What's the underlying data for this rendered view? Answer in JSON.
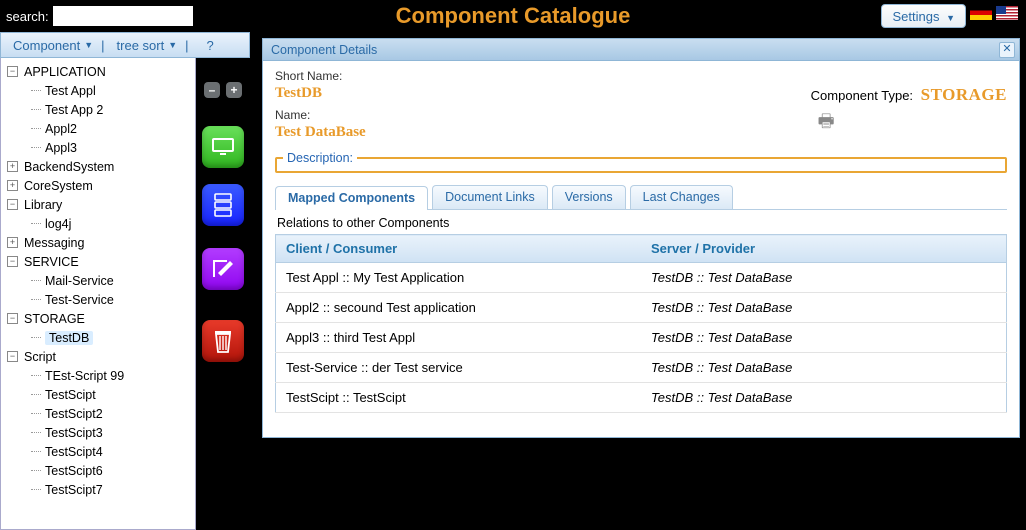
{
  "header": {
    "search_label": "search:",
    "search_value": "",
    "title": "Component Catalogue",
    "settings_label": "Settings"
  },
  "toolbar": {
    "component_label": "Component",
    "sort_label": "tree sort",
    "help_label": "?"
  },
  "tree": [
    {
      "label": "APPLICATION",
      "depth": 0,
      "exp": "-"
    },
    {
      "label": "Test Appl",
      "depth": 1
    },
    {
      "label": "Test App 2",
      "depth": 1
    },
    {
      "label": "Appl2",
      "depth": 1
    },
    {
      "label": "Appl3",
      "depth": 1
    },
    {
      "label": "BackendSystem",
      "depth": 0,
      "exp": "+"
    },
    {
      "label": "CoreSystem",
      "depth": 0,
      "exp": "+"
    },
    {
      "label": "Library",
      "depth": 0,
      "exp": "-"
    },
    {
      "label": "log4j",
      "depth": 1
    },
    {
      "label": "Messaging",
      "depth": 0,
      "exp": "+"
    },
    {
      "label": "SERVICE",
      "depth": 0,
      "exp": "-"
    },
    {
      "label": "Mail-Service",
      "depth": 1
    },
    {
      "label": "Test-Service",
      "depth": 1
    },
    {
      "label": "STORAGE",
      "depth": 0,
      "exp": "-"
    },
    {
      "label": "TestDB",
      "depth": 1,
      "selected": true
    },
    {
      "label": "Script",
      "depth": 0,
      "exp": "-"
    },
    {
      "label": "TEst-Script 99",
      "depth": 1
    },
    {
      "label": "TestScipt",
      "depth": 1
    },
    {
      "label": "TestScipt2",
      "depth": 1
    },
    {
      "label": "TestScipt3",
      "depth": 1
    },
    {
      "label": "TestScipt4",
      "depth": 1
    },
    {
      "label": "TestScipt6",
      "depth": 1
    },
    {
      "label": "TestScipt7",
      "depth": 1
    }
  ],
  "side_icons": {
    "collapse": "–",
    "expand": "+"
  },
  "panel": {
    "title": "Component Details",
    "short_name_label": "Short Name:",
    "short_name_value": "TestDB",
    "name_label": "Name:",
    "name_value": "Test DataBase",
    "type_label": "Component Type:",
    "type_value": "STORAGE",
    "description_label": "Description:",
    "tabs": [
      "Mapped Components",
      "Document Links",
      "Versions",
      "Last Changes"
    ],
    "active_tab": 0,
    "relations_title": "Relations to other Components",
    "columns": [
      "Client / Consumer",
      "Server / Provider"
    ],
    "rows": [
      {
        "client": "Test Appl :: My Test Application",
        "provider": "TestDB :: Test DataBase"
      },
      {
        "client": "Appl2 :: secound Test application",
        "provider": "TestDB :: Test DataBase"
      },
      {
        "client": "Appl3 :: third Test Appl",
        "provider": "TestDB :: Test DataBase"
      },
      {
        "client": "Test-Service :: der Test service",
        "provider": "TestDB :: Test DataBase"
      },
      {
        "client": "TestScipt :: TestScipt",
        "provider": "TestDB :: Test DataBase"
      }
    ]
  }
}
